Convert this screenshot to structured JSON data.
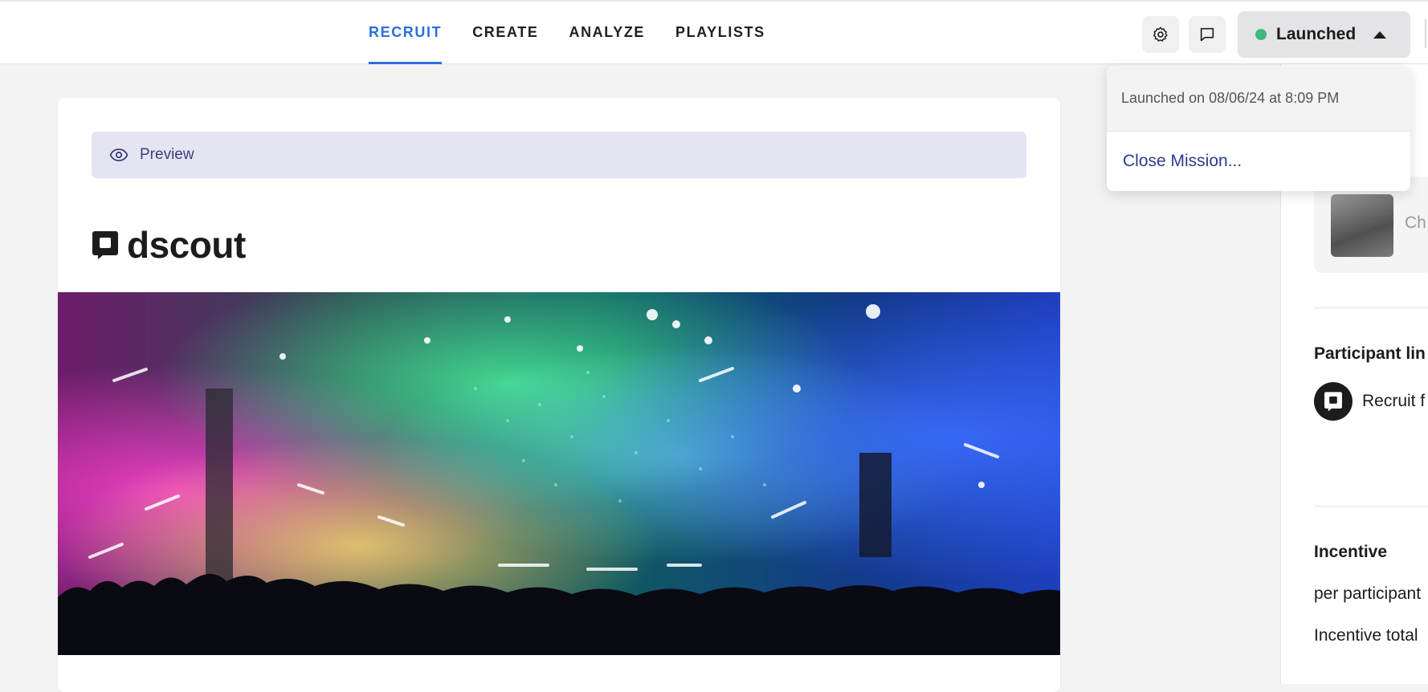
{
  "nav": {
    "tabs": [
      {
        "label": "RECRUIT",
        "active": true
      },
      {
        "label": "CREATE",
        "active": false
      },
      {
        "label": "ANALYZE",
        "active": false
      },
      {
        "label": "PLAYLISTS",
        "active": false
      }
    ]
  },
  "header": {
    "settings_icon": "gear-icon",
    "comments_icon": "chat-bubble-icon",
    "status": {
      "label": "Launched",
      "dot_color": "#3fb97a"
    }
  },
  "dropdown": {
    "launched_info": "Launched on 08/06/24 at 8:09 PM",
    "close_mission_label": "Close Mission..."
  },
  "main": {
    "preview_label": "Preview",
    "logo_text": "dscout"
  },
  "right_panel": {
    "thumb_label": "Ch",
    "participant_heading": "Participant lin",
    "recruit_label": "Recruit f",
    "incentive_heading": "Incentive",
    "per_participant_label": "per participant",
    "incentive_total_label": "Incentive total"
  },
  "colors": {
    "accent": "#2a6fdb",
    "preview_bg": "#e4e4f3",
    "link": "#2d3a8c"
  }
}
